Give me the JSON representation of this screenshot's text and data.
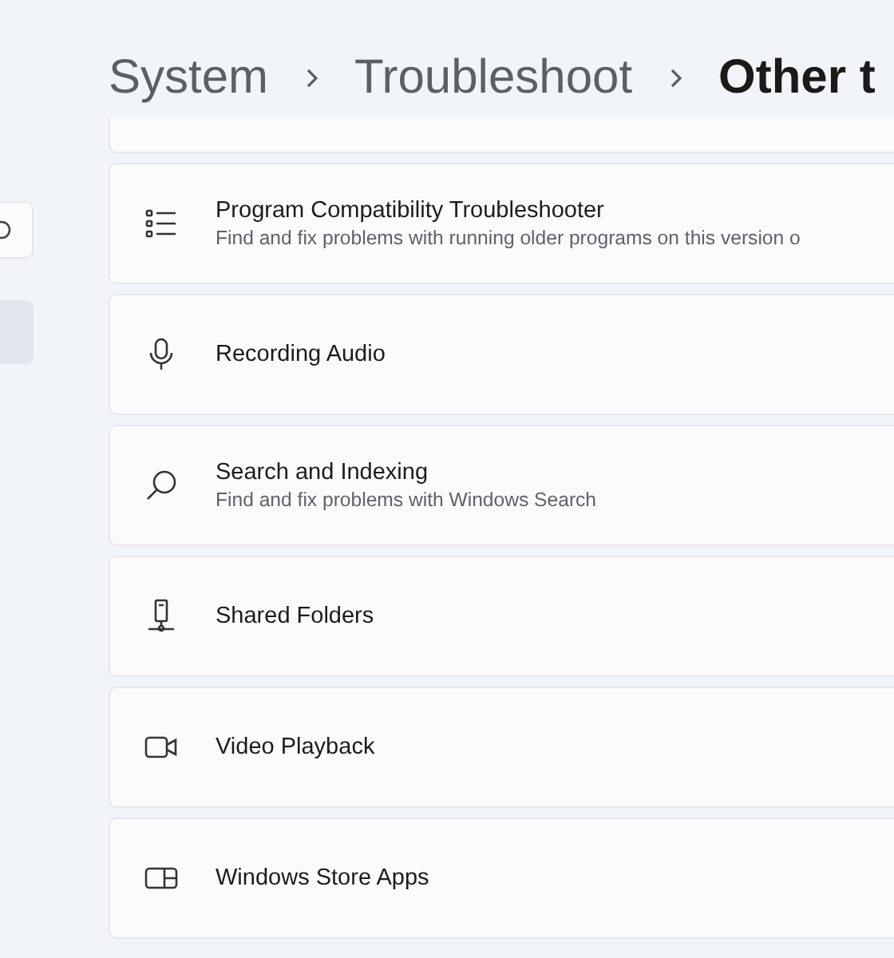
{
  "sidebar": {
    "items": [
      {
        "selected": true
      }
    ]
  },
  "breadcrumb": [
    {
      "label": "System",
      "current": false
    },
    {
      "label": "Troubleshoot",
      "current": false
    },
    {
      "label": "Other t",
      "current": true
    }
  ],
  "troubleshooters": [
    {
      "kind": "partial"
    },
    {
      "kind": "list",
      "title": "Program Compatibility Troubleshooter",
      "description": "Find and fix problems with running older programs on this version o"
    },
    {
      "kind": "microphone",
      "title": "Recording Audio"
    },
    {
      "kind": "search",
      "title": "Search and Indexing",
      "description": "Find and fix problems with Windows Search"
    },
    {
      "kind": "share",
      "title": "Shared Folders"
    },
    {
      "kind": "video",
      "title": "Video Playback"
    },
    {
      "kind": "store",
      "title": "Windows Store Apps"
    }
  ]
}
